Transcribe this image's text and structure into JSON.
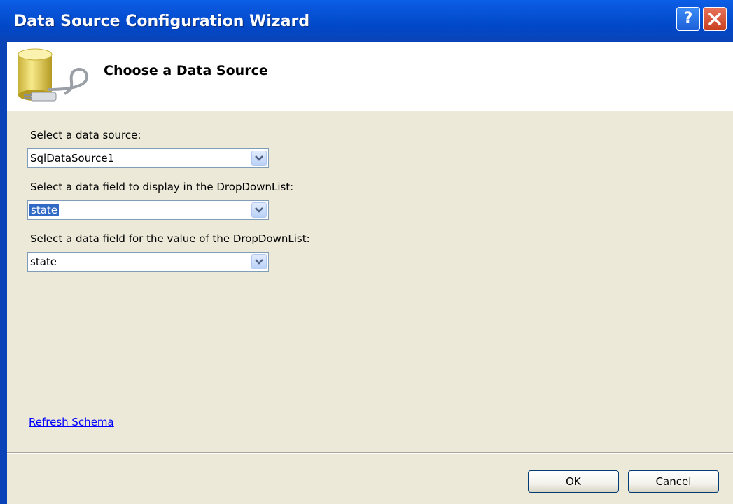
{
  "window": {
    "title": "Data Source Configuration Wizard"
  },
  "titlebar_buttons": {
    "help_label": "?",
    "help_icon": "help-icon",
    "close_icon": "close-icon"
  },
  "header": {
    "title": "Choose a Data Source",
    "icon": "database-plug-icon"
  },
  "fields": {
    "data_source": {
      "label": "Select a data source:",
      "value": "SqlDataSource1"
    },
    "display_field": {
      "label": "Select a data field to display in the DropDownList:",
      "value": "state"
    },
    "value_field": {
      "label": "Select a data field for the value of the DropDownList:",
      "value": "state"
    }
  },
  "links": {
    "refresh_schema": "Refresh Schema"
  },
  "buttons": {
    "ok": "OK",
    "cancel": "Cancel"
  },
  "colors": {
    "titlebar": "#0049c9",
    "body": "#ece9d8",
    "selection": "#316ac5",
    "link": "#0000ff"
  }
}
